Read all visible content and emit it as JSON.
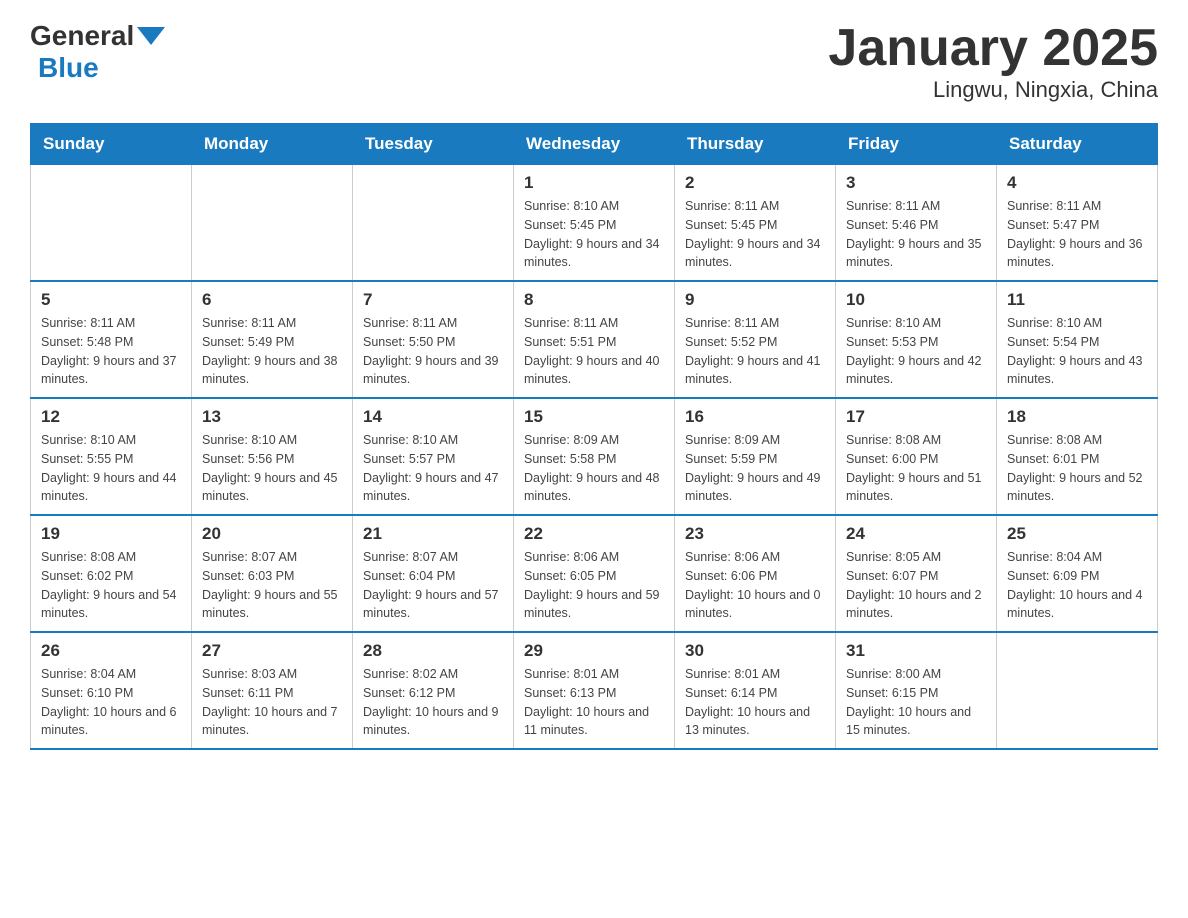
{
  "header": {
    "logo_general": "General",
    "logo_blue": "Blue",
    "title": "January 2025",
    "subtitle": "Lingwu, Ningxia, China"
  },
  "weekdays": [
    "Sunday",
    "Monday",
    "Tuesday",
    "Wednesday",
    "Thursday",
    "Friday",
    "Saturday"
  ],
  "weeks": [
    [
      {
        "day": "",
        "info": ""
      },
      {
        "day": "",
        "info": ""
      },
      {
        "day": "",
        "info": ""
      },
      {
        "day": "1",
        "info": "Sunrise: 8:10 AM\nSunset: 5:45 PM\nDaylight: 9 hours and 34 minutes."
      },
      {
        "day": "2",
        "info": "Sunrise: 8:11 AM\nSunset: 5:45 PM\nDaylight: 9 hours and 34 minutes."
      },
      {
        "day": "3",
        "info": "Sunrise: 8:11 AM\nSunset: 5:46 PM\nDaylight: 9 hours and 35 minutes."
      },
      {
        "day": "4",
        "info": "Sunrise: 8:11 AM\nSunset: 5:47 PM\nDaylight: 9 hours and 36 minutes."
      }
    ],
    [
      {
        "day": "5",
        "info": "Sunrise: 8:11 AM\nSunset: 5:48 PM\nDaylight: 9 hours and 37 minutes."
      },
      {
        "day": "6",
        "info": "Sunrise: 8:11 AM\nSunset: 5:49 PM\nDaylight: 9 hours and 38 minutes."
      },
      {
        "day": "7",
        "info": "Sunrise: 8:11 AM\nSunset: 5:50 PM\nDaylight: 9 hours and 39 minutes."
      },
      {
        "day": "8",
        "info": "Sunrise: 8:11 AM\nSunset: 5:51 PM\nDaylight: 9 hours and 40 minutes."
      },
      {
        "day": "9",
        "info": "Sunrise: 8:11 AM\nSunset: 5:52 PM\nDaylight: 9 hours and 41 minutes."
      },
      {
        "day": "10",
        "info": "Sunrise: 8:10 AM\nSunset: 5:53 PM\nDaylight: 9 hours and 42 minutes."
      },
      {
        "day": "11",
        "info": "Sunrise: 8:10 AM\nSunset: 5:54 PM\nDaylight: 9 hours and 43 minutes."
      }
    ],
    [
      {
        "day": "12",
        "info": "Sunrise: 8:10 AM\nSunset: 5:55 PM\nDaylight: 9 hours and 44 minutes."
      },
      {
        "day": "13",
        "info": "Sunrise: 8:10 AM\nSunset: 5:56 PM\nDaylight: 9 hours and 45 minutes."
      },
      {
        "day": "14",
        "info": "Sunrise: 8:10 AM\nSunset: 5:57 PM\nDaylight: 9 hours and 47 minutes."
      },
      {
        "day": "15",
        "info": "Sunrise: 8:09 AM\nSunset: 5:58 PM\nDaylight: 9 hours and 48 minutes."
      },
      {
        "day": "16",
        "info": "Sunrise: 8:09 AM\nSunset: 5:59 PM\nDaylight: 9 hours and 49 minutes."
      },
      {
        "day": "17",
        "info": "Sunrise: 8:08 AM\nSunset: 6:00 PM\nDaylight: 9 hours and 51 minutes."
      },
      {
        "day": "18",
        "info": "Sunrise: 8:08 AM\nSunset: 6:01 PM\nDaylight: 9 hours and 52 minutes."
      }
    ],
    [
      {
        "day": "19",
        "info": "Sunrise: 8:08 AM\nSunset: 6:02 PM\nDaylight: 9 hours and 54 minutes."
      },
      {
        "day": "20",
        "info": "Sunrise: 8:07 AM\nSunset: 6:03 PM\nDaylight: 9 hours and 55 minutes."
      },
      {
        "day": "21",
        "info": "Sunrise: 8:07 AM\nSunset: 6:04 PM\nDaylight: 9 hours and 57 minutes."
      },
      {
        "day": "22",
        "info": "Sunrise: 8:06 AM\nSunset: 6:05 PM\nDaylight: 9 hours and 59 minutes."
      },
      {
        "day": "23",
        "info": "Sunrise: 8:06 AM\nSunset: 6:06 PM\nDaylight: 10 hours and 0 minutes."
      },
      {
        "day": "24",
        "info": "Sunrise: 8:05 AM\nSunset: 6:07 PM\nDaylight: 10 hours and 2 minutes."
      },
      {
        "day": "25",
        "info": "Sunrise: 8:04 AM\nSunset: 6:09 PM\nDaylight: 10 hours and 4 minutes."
      }
    ],
    [
      {
        "day": "26",
        "info": "Sunrise: 8:04 AM\nSunset: 6:10 PM\nDaylight: 10 hours and 6 minutes."
      },
      {
        "day": "27",
        "info": "Sunrise: 8:03 AM\nSunset: 6:11 PM\nDaylight: 10 hours and 7 minutes."
      },
      {
        "day": "28",
        "info": "Sunrise: 8:02 AM\nSunset: 6:12 PM\nDaylight: 10 hours and 9 minutes."
      },
      {
        "day": "29",
        "info": "Sunrise: 8:01 AM\nSunset: 6:13 PM\nDaylight: 10 hours and 11 minutes."
      },
      {
        "day": "30",
        "info": "Sunrise: 8:01 AM\nSunset: 6:14 PM\nDaylight: 10 hours and 13 minutes."
      },
      {
        "day": "31",
        "info": "Sunrise: 8:00 AM\nSunset: 6:15 PM\nDaylight: 10 hours and 15 minutes."
      },
      {
        "day": "",
        "info": ""
      }
    ]
  ]
}
